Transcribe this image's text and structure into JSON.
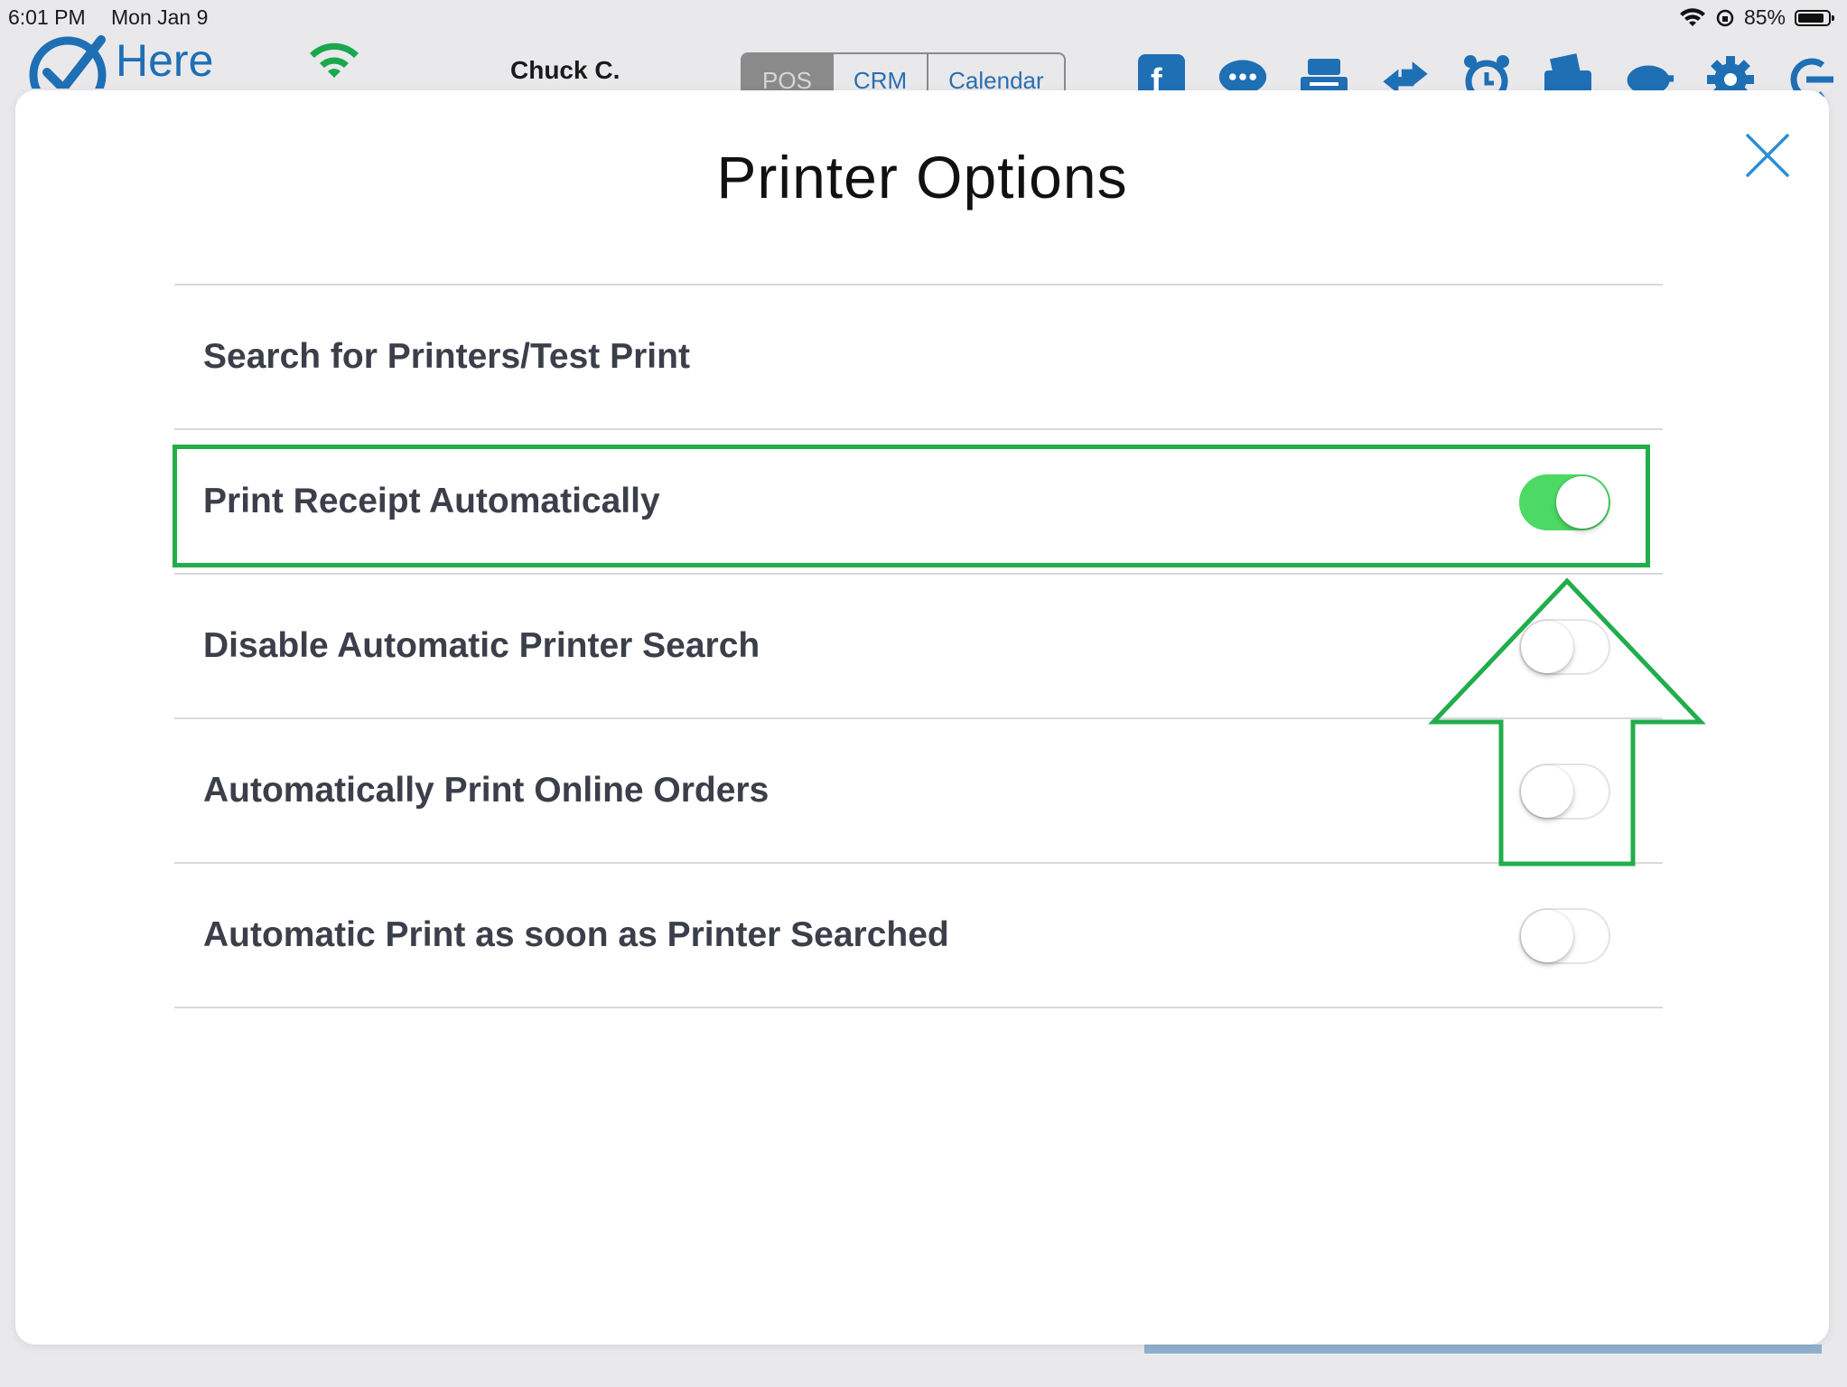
{
  "status_bar": {
    "time": "6:01 PM",
    "date": "Mon Jan 9",
    "battery": "85%",
    "battery_level": 0.85
  },
  "header": {
    "logo_text": "Here",
    "user_name": "Chuck C.",
    "tabs": [
      {
        "label": "POS",
        "active": true
      },
      {
        "label": "CRM",
        "active": false
      },
      {
        "label": "Calendar",
        "active": false
      }
    ],
    "toolbar_icons": [
      "facebook-icon",
      "chat-icon",
      "register-icon",
      "transfer-icon",
      "alarm-clock-icon",
      "wallet-icon",
      "piggy-bank-icon",
      "gear-icon",
      "logout-icon"
    ]
  },
  "modal": {
    "title": "Printer Options",
    "options": [
      {
        "label": "Search for Printers/Test Print"
      },
      {
        "label": "Print Receipt Automatically",
        "enabled": true
      },
      {
        "label": "Disable Automatic Printer Search",
        "enabled": false
      },
      {
        "label": "Automatically Print Online Orders",
        "enabled": false
      },
      {
        "label": "Automatic Print as soon as Printer Searched",
        "enabled": false
      }
    ]
  },
  "colors": {
    "accent_blue": "#1f6fb5",
    "toggle_on": "#4cd964",
    "annotation_green": "#22ad4c"
  }
}
